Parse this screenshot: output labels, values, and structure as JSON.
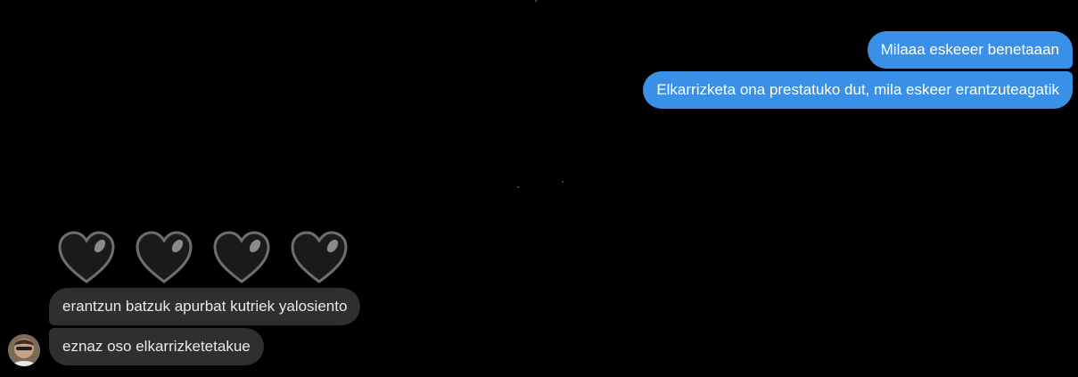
{
  "conversation": {
    "outgoing": [
      {
        "text": "Milaaa eskeeer benetaaan"
      },
      {
        "text": "Elkarrizketa ona prestatuko dut, mila eskeer erantzuteagatik"
      }
    ],
    "reaction": {
      "icon": "black-heart-icon",
      "count": 4
    },
    "incoming": [
      {
        "text": "erantzun batzuk apurbat kutriek yalosiento"
      },
      {
        "text": "eznaz oso elkarrizketetakue"
      }
    ]
  },
  "colors": {
    "background": "#000000",
    "outgoing_bubble": "#3a8fe6",
    "incoming_bubble": "#2f2f2f",
    "text": "#ffffff"
  }
}
